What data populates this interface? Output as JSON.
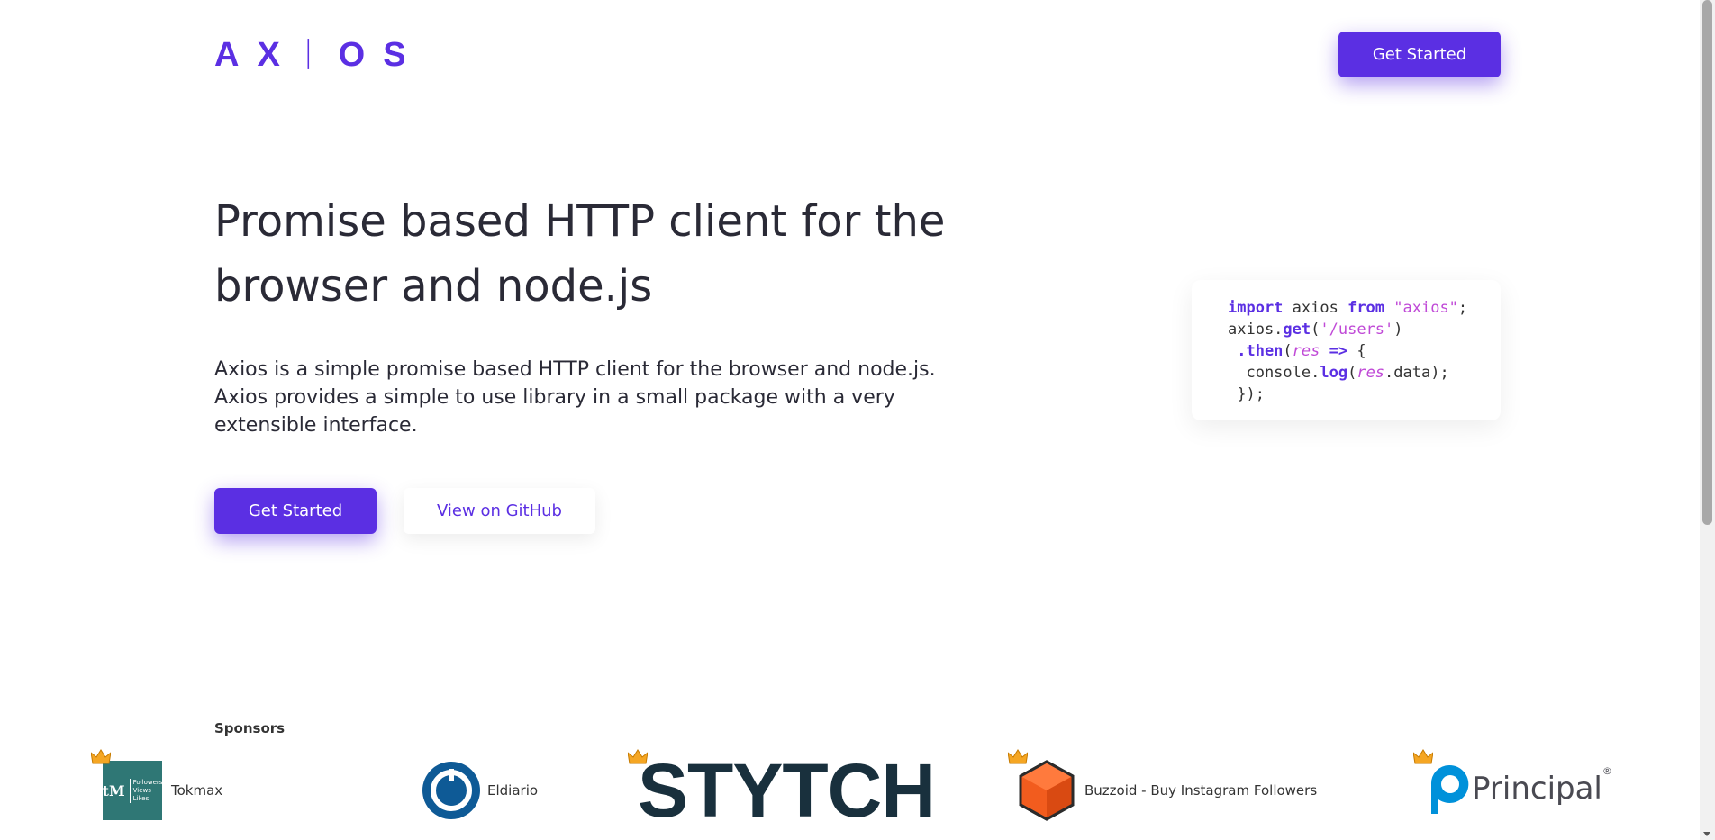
{
  "header": {
    "logo_letters": [
      "A",
      "X",
      "ᛁ",
      "O",
      "S"
    ],
    "cta_label": "Get Started"
  },
  "hero": {
    "title": "Promise based HTTP client for the browser and node.js",
    "description": "Axios is a simple promise based HTTP client for the browser and node.js. Axios provides a simple to use library in a small package with a very extensible interface.",
    "primary_label": "Get Started",
    "secondary_label": "View on GitHub"
  },
  "code": {
    "line1": {
      "kw_import": "import",
      "ident": " axios ",
      "kw_from": "from",
      "str": " \"axios\"",
      "end": ";"
    },
    "line2": {
      "obj": "axios.",
      "method": "get",
      "open": "(",
      "str": "'/users'",
      "close": ")"
    },
    "line3": {
      "method": " .then",
      "open": "(",
      "param": "res",
      "arrow": " => ",
      "brace": "{"
    },
    "line4": {
      "obj": "  console.",
      "method": "log",
      "open": "(",
      "param": "res",
      "rest": ".data);"
    },
    "line5": {
      "text": " });"
    }
  },
  "sponsors": {
    "label": "Sponsors",
    "items": [
      {
        "name": "Tokmax",
        "logo_text": [
          "Followers",
          "Views",
          "Likes"
        ]
      },
      {
        "name": "Eldiario"
      },
      {
        "name": "STYTCH"
      },
      {
        "name": "Buzzoid - Buy Instagram Followers"
      },
      {
        "name": "Principal",
        "registered": "®"
      }
    ]
  },
  "colors": {
    "accent": "#5b2fe3",
    "code_string": "#c04ad7",
    "text": "#2a2a36",
    "crown": "#f5a623",
    "stytch": "#19303d",
    "buzzoid": "#f25c1e",
    "principal": "#0091da"
  }
}
